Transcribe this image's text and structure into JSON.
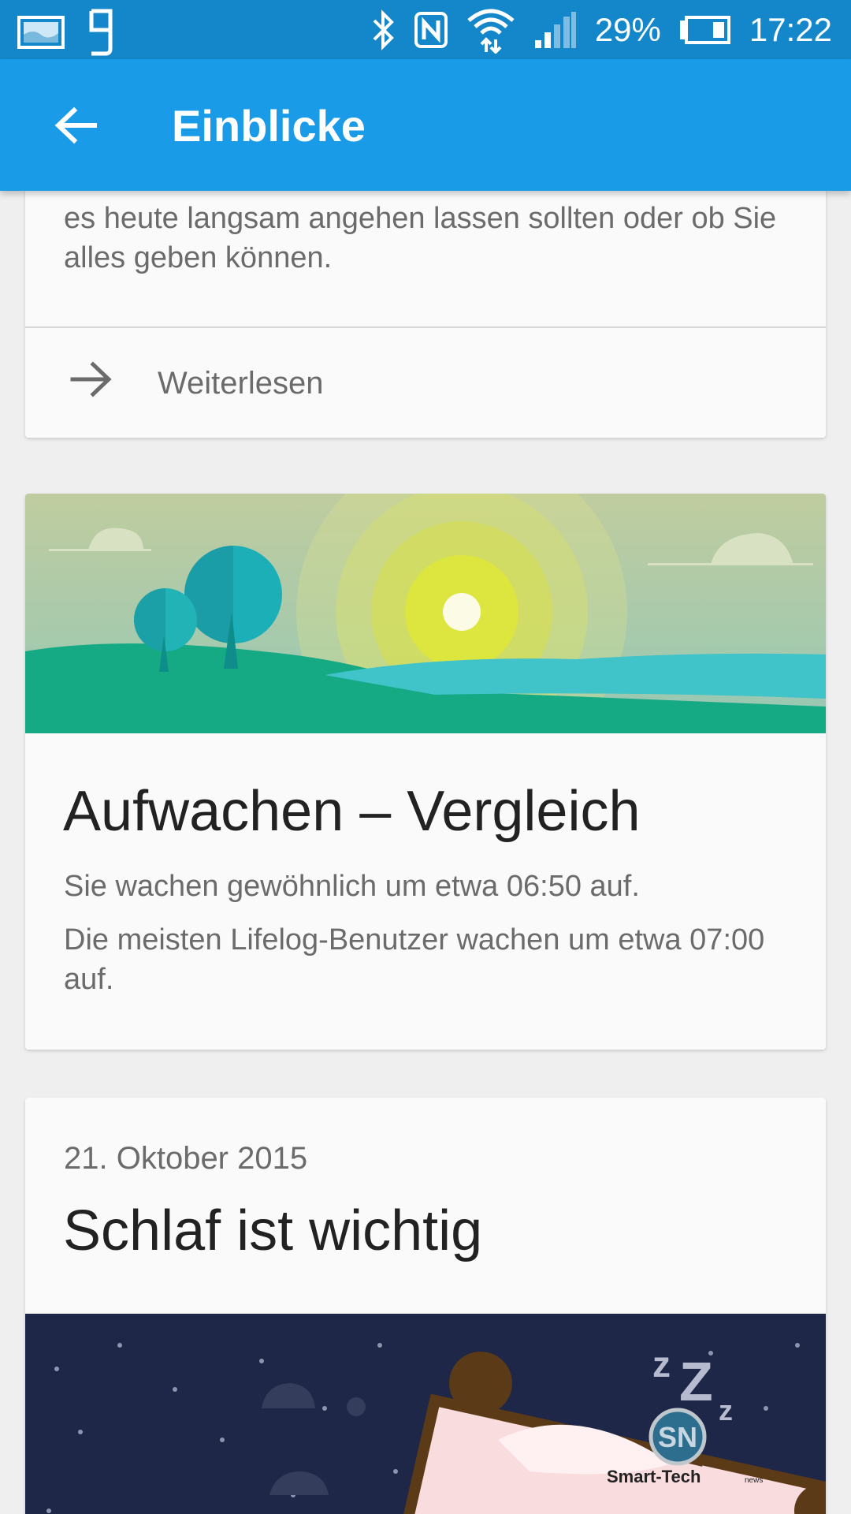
{
  "status_bar": {
    "battery": "29%",
    "time": "17:22",
    "icons": [
      "image-notification-icon",
      "g-notification-icon",
      "bluetooth-icon",
      "nfc-icon",
      "wifi-icon",
      "signal-icon",
      "battery-icon"
    ]
  },
  "toolbar": {
    "title": "Einblicke",
    "back_icon": "arrow-left-icon"
  },
  "cards": {
    "intro": {
      "text": "es heute langsam angehen lassen sollten oder ob Sie alles geben können.",
      "read_more": "Weiterlesen"
    },
    "wake": {
      "title": "Aufwachen – Vergleich",
      "line1": "Sie wachen gewöhnlich um etwa 06:50 auf.",
      "line2": "Die meisten Lifelog-Benutzer wachen um etwa 07:00 auf."
    },
    "sleep": {
      "date": "21. Oktober 2015",
      "title": "Schlaf ist wichtig"
    }
  },
  "watermark": {
    "logo_text": "SN",
    "brand": "Smart-Tech",
    "suffix": "news"
  },
  "colors": {
    "status_bar": "#1487cb",
    "toolbar": "#1a9be8",
    "background": "#efefef",
    "card": "#fafafa"
  }
}
